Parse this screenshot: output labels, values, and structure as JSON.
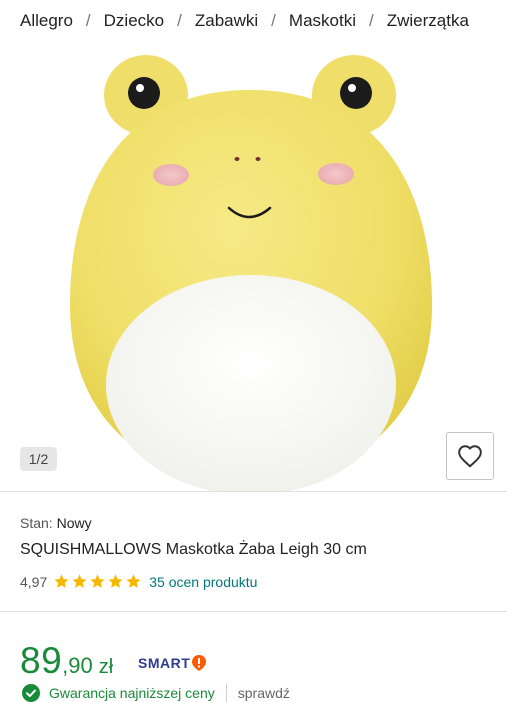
{
  "breadcrumb": {
    "items": [
      "Allegro",
      "Dziecko",
      "Zabawki",
      "Maskotki",
      "Zwierzątka"
    ]
  },
  "gallery": {
    "counter": "1/2",
    "image_subject": "yellow frog plush toy"
  },
  "product": {
    "condition_label": "Stan:",
    "condition_value": "Nowy",
    "title": "SQUISHMALLOWS Maskotka Żaba Leigh 30 cm",
    "rating": "4,97",
    "stars": 5,
    "reviews_link": "35 ocen produktu"
  },
  "price": {
    "integer": "89",
    "decimal": ",90",
    "currency": "zł",
    "smart_label": "SMART"
  },
  "guarantee": {
    "text": "Gwarancja najniższej ceny",
    "link": "sprawdź"
  },
  "colors": {
    "price_green": "#188a39",
    "link_teal": "#00787a",
    "star_gold": "#f5b800",
    "smart_blue": "#2f3b93",
    "smart_orange": "#ff5a00"
  },
  "icons": [
    "heart-icon",
    "star-icon",
    "check-circle-icon",
    "smart-logo-icon"
  ]
}
